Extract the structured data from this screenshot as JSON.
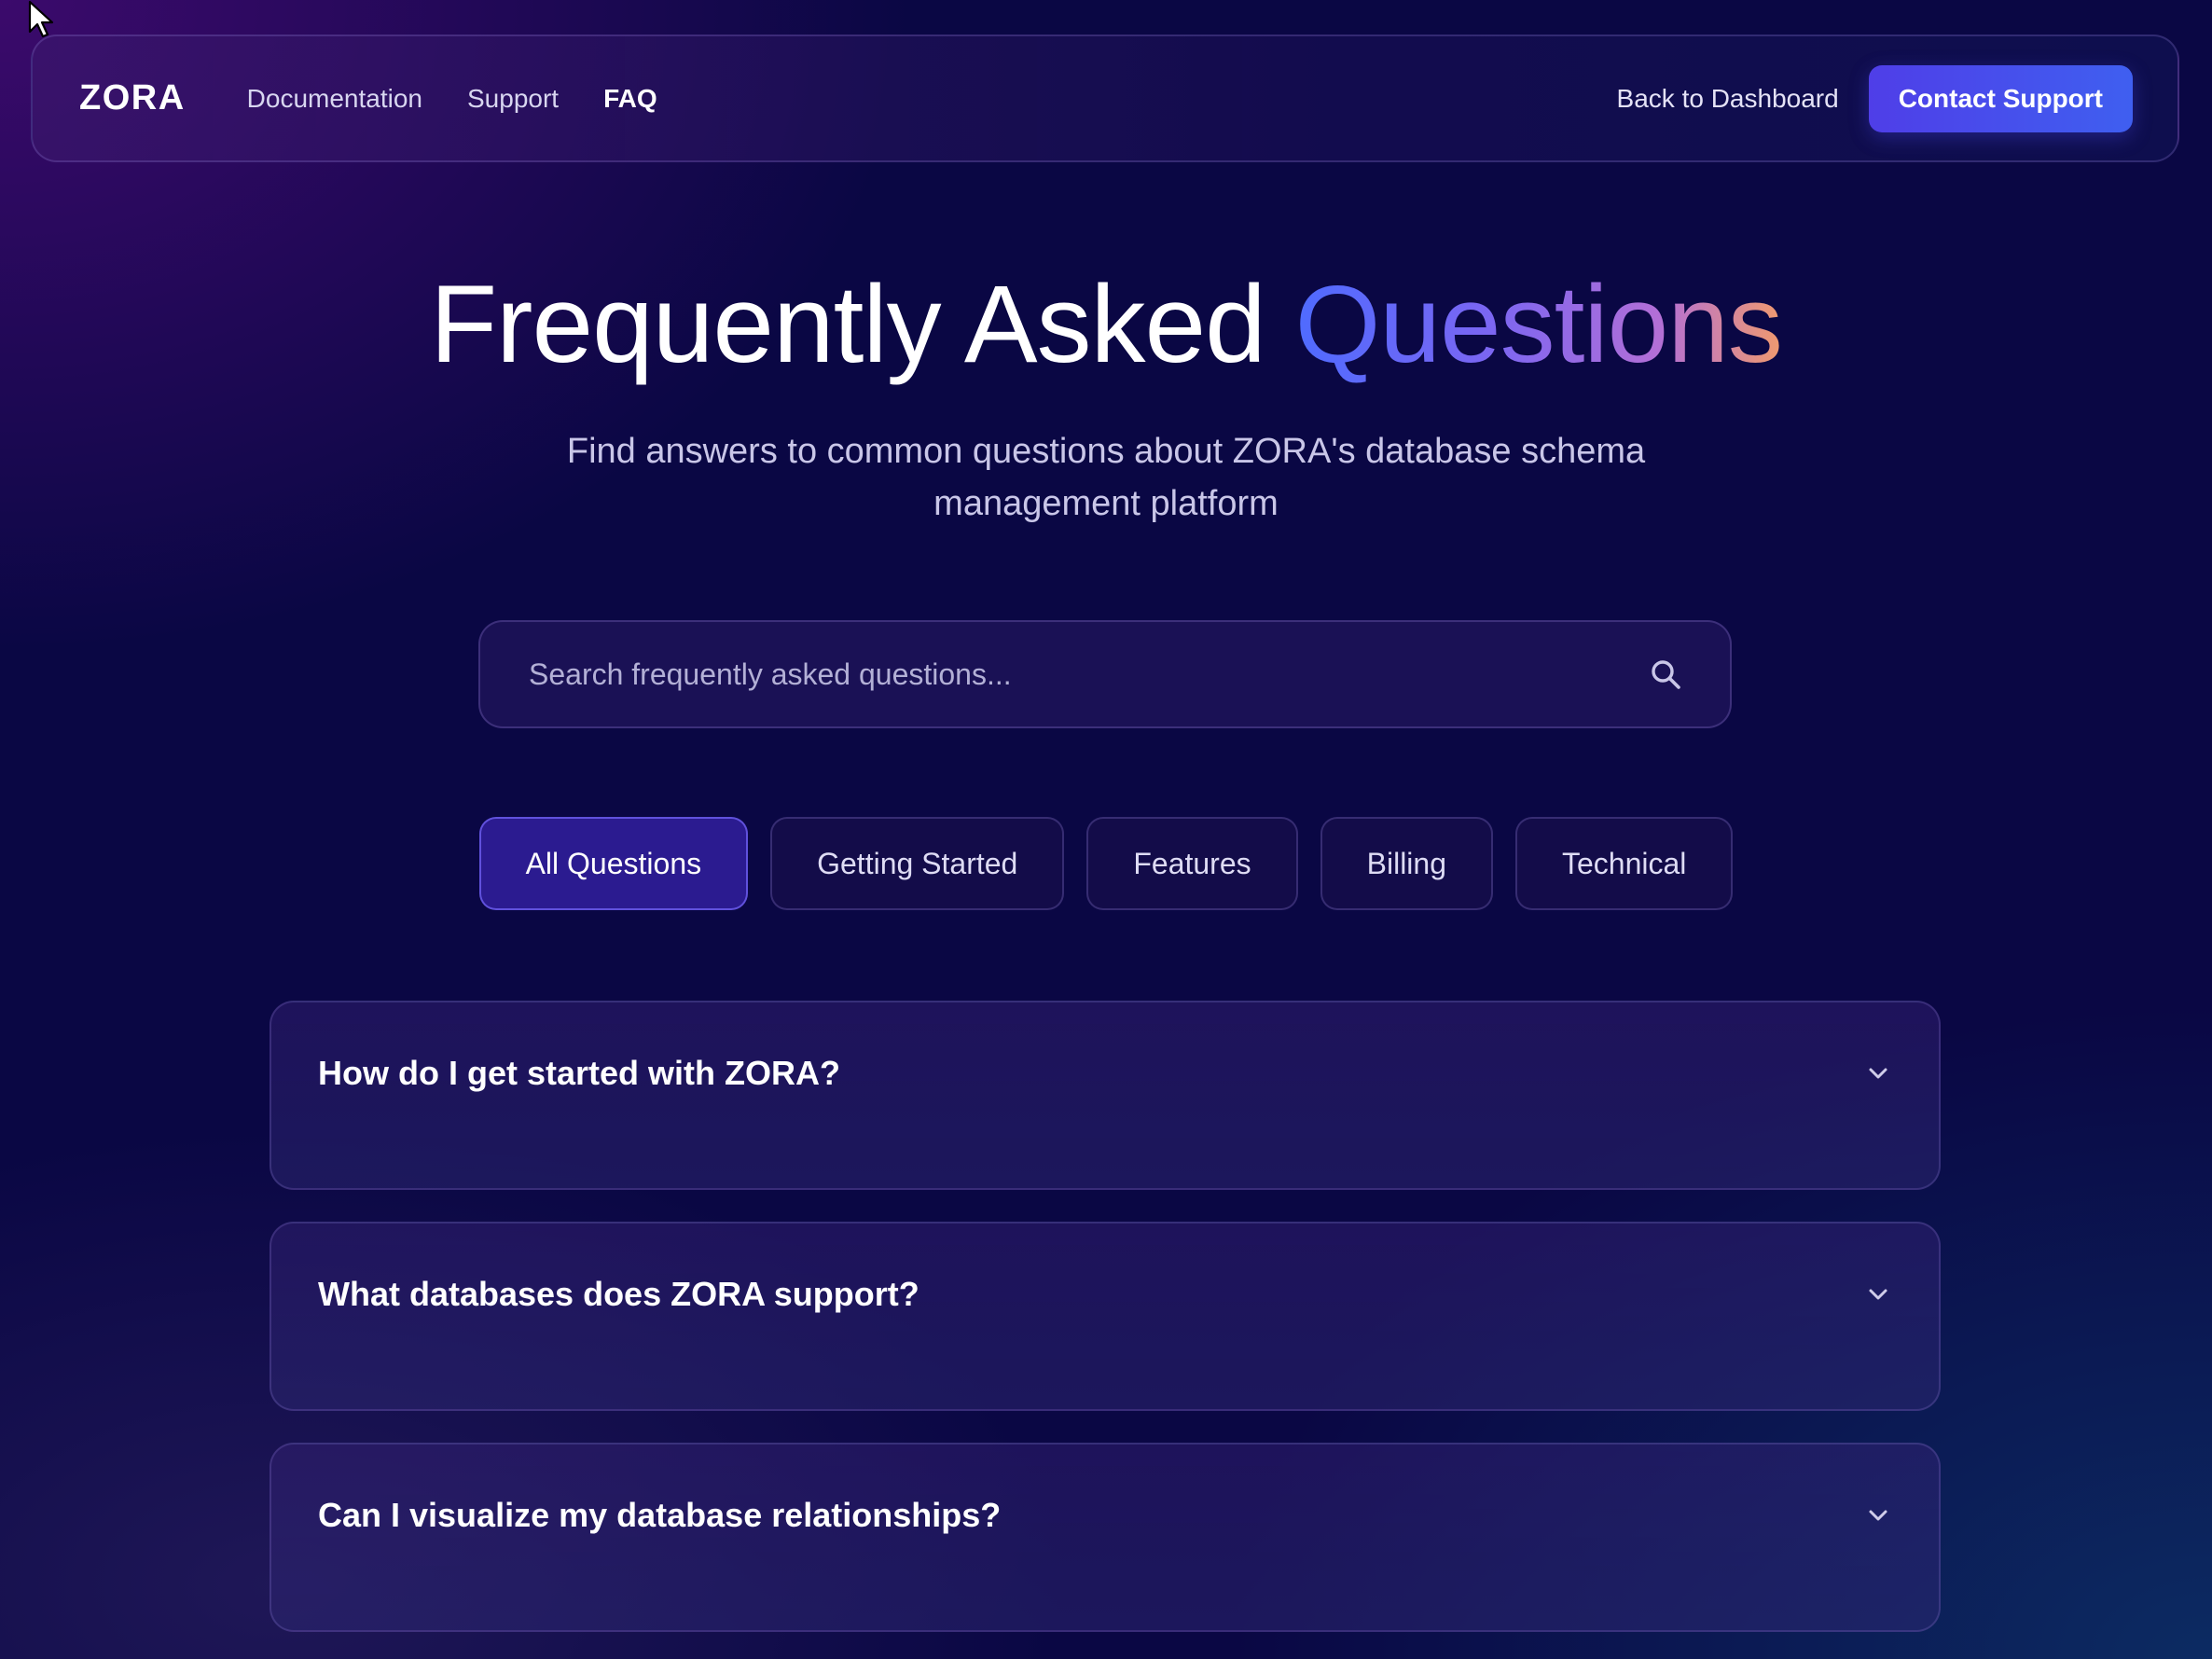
{
  "nav": {
    "logo": "ZORA",
    "links": [
      {
        "label": "Documentation"
      },
      {
        "label": "Support"
      },
      {
        "label": "FAQ"
      }
    ],
    "back_label": "Back to Dashboard",
    "contact_label": "Contact Support"
  },
  "hero": {
    "title_plain": "Frequently Asked",
    "title_accent": "Questions",
    "subtitle": "Find answers to common questions about ZORA's database schema management platform"
  },
  "search": {
    "placeholder": "Search frequently asked questions...",
    "value": ""
  },
  "categories": [
    {
      "label": "All Questions",
      "active": true
    },
    {
      "label": "Getting Started",
      "active": false
    },
    {
      "label": "Features",
      "active": false
    },
    {
      "label": "Billing",
      "active": false
    },
    {
      "label": "Technical",
      "active": false
    }
  ],
  "faqs": [
    {
      "question": "How do I get started with ZORA?"
    },
    {
      "question": "What databases does ZORA support?"
    },
    {
      "question": "Can I visualize my database relationships?"
    }
  ],
  "colors": {
    "background": "#0a0744",
    "accent_button": "#4f3ee8",
    "active_pill": "#3723aa",
    "title_gradient": [
      "#4f6bff",
      "#7b66f2",
      "#b36fd6",
      "#f09a6e"
    ]
  },
  "icons": {
    "cursor": "mouse-pointer-icon",
    "search": "search-icon",
    "faq_toggle": "chevron-down-icon"
  }
}
